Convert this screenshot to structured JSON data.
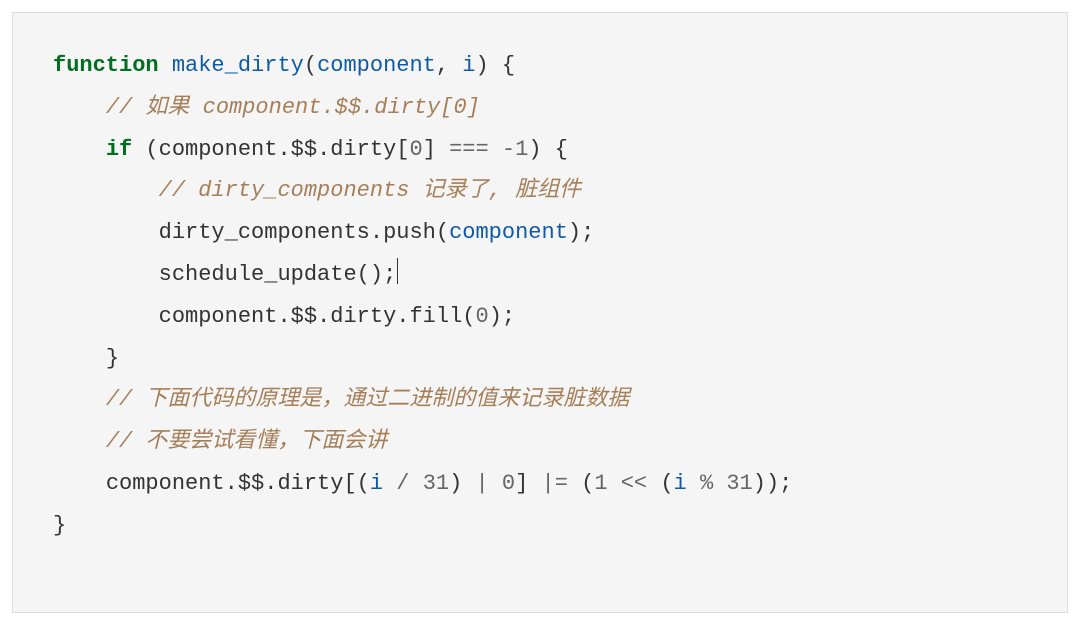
{
  "code": {
    "l1": {
      "kw_function": "function",
      "fname": "make_dirty",
      "p_open": "(",
      "arg1": "component",
      "comma": ", ",
      "arg2": "i",
      "p_close": ")",
      "brace_open": " {"
    },
    "l2": {
      "indent": "    ",
      "comment": "// 如果 component.$$.dirty[0]"
    },
    "l3": {
      "indent": "    ",
      "kw_if": "if",
      "paren_open": " (",
      "obj": "component",
      "dot1": ".",
      "dd": "$$",
      "dot2": ".",
      "dirty": "dirty",
      "br_open": "[",
      "zero": "0",
      "br_close": "]",
      "eq": " === ",
      "neg1": "-1",
      "paren_close": ") ",
      "brace": "{"
    },
    "l4": {
      "indent": "        ",
      "comment": "// dirty_components 记录了, 脏组件"
    },
    "l5": {
      "indent": "        ",
      "dc": "dirty_components",
      "dot": ".",
      "push": "push",
      "po": "(",
      "arg": "component",
      "pc": ");"
    },
    "l6": {
      "indent": "        ",
      "su": "schedule_update",
      "call": "();"
    },
    "l7": {
      "indent": "        ",
      "obj": "component",
      "dot1": ".",
      "dd": "$$",
      "dot2": ".",
      "dirty": "dirty",
      "dot3": ".",
      "fill": "fill",
      "po": "(",
      "zero": "0",
      "pc": ");"
    },
    "l8": {
      "indent": "    ",
      "brace": "}"
    },
    "l9": {
      "indent": "    ",
      "comment": "// 下面代码的原理是，通过二进制的值来记录脏数据"
    },
    "l10": {
      "indent": "    ",
      "comment": "// 不要尝试看懂，下面会讲"
    },
    "l11": {
      "indent": "    ",
      "obj": "component",
      "dot1": ".",
      "dd": "$$",
      "dot2": ".",
      "dirty": "dirty",
      "br_open": "[",
      "po1": "(",
      "i1": "i",
      "div": " / ",
      "n31a": "31",
      "pc1": ")",
      "bar": " | ",
      "z0": "0",
      "br_close": "]",
      "oreq": " |= ",
      "po2": "(",
      "one": "1",
      "shl": " << ",
      "po3": "(",
      "i2": "i",
      "mod": " % ",
      "n31b": "31",
      "pc3": ")",
      "pc2": ");"
    },
    "l12": {
      "brace": "}"
    }
  }
}
